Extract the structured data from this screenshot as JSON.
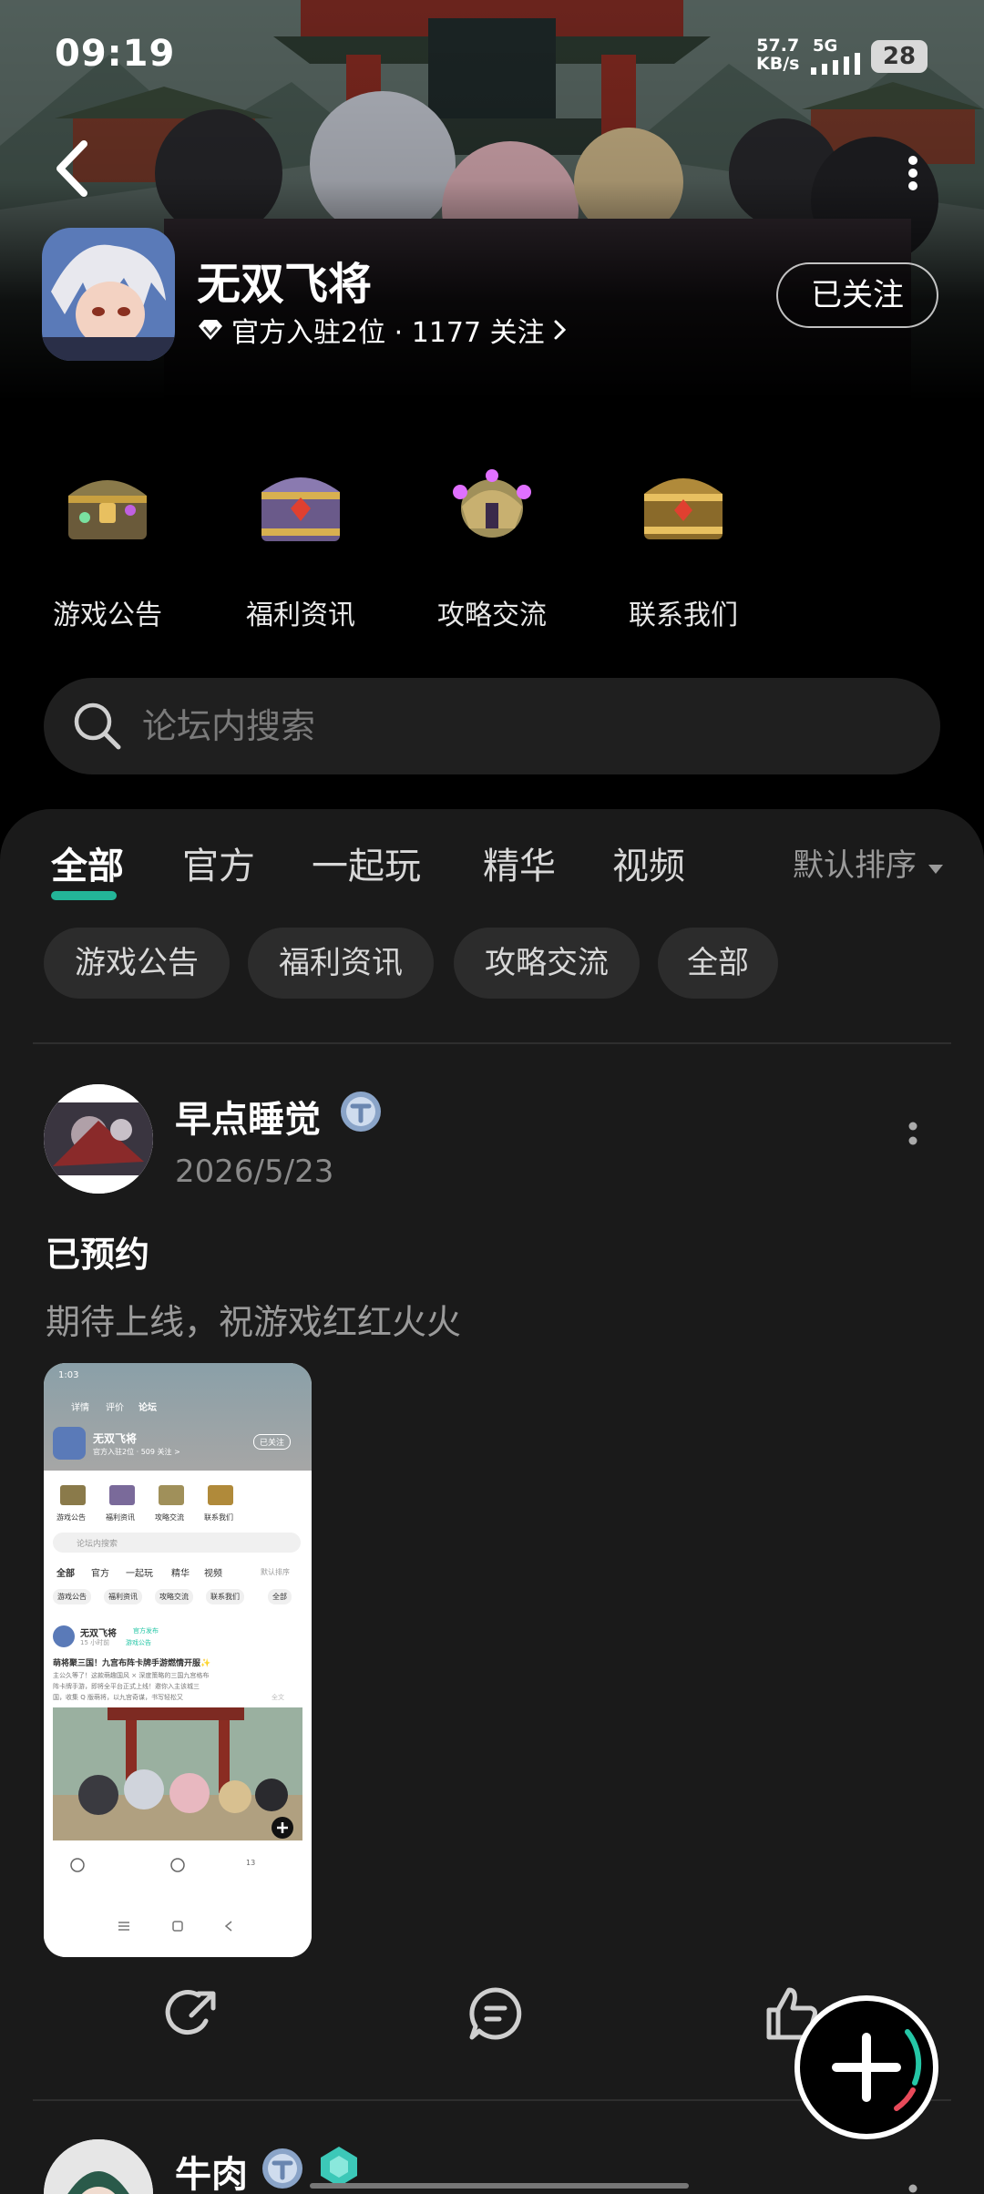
{
  "status_bar": {
    "time": "09:19",
    "net_speed_value": "57.7",
    "net_speed_unit": "KB/s",
    "network": "5G",
    "battery": "28"
  },
  "header": {
    "app_name": "无双飞将",
    "meta": "官方入驻2位 · 1177 关注",
    "follow_label": "已关注"
  },
  "categories": [
    {
      "label": "游戏公告",
      "icon": "chest-icon"
    },
    {
      "label": "福利资讯",
      "icon": "purple-chest-icon"
    },
    {
      "label": "攻略交流",
      "icon": "gold-helmet-icon"
    },
    {
      "label": "联系我们",
      "icon": "gold-chest-icon"
    }
  ],
  "search": {
    "placeholder": "论坛内搜索"
  },
  "tabs": [
    {
      "label": "全部",
      "active": true
    },
    {
      "label": "官方",
      "active": false
    },
    {
      "label": "一起玩",
      "active": false
    },
    {
      "label": "精华",
      "active": false
    },
    {
      "label": "视频",
      "active": false
    }
  ],
  "sort_label": "默认排序",
  "chips": [
    "游戏公告",
    "福利资讯",
    "攻略交流",
    "全部"
  ],
  "post": {
    "author": "早点睡觉",
    "date": "2026/5/23",
    "title": "已预约",
    "body": "期待上线，祝游戏红红火火",
    "screenshot": {
      "time": "1:03",
      "tab_details": "详情",
      "tab_reviews": "评价",
      "tab_forum": "论坛",
      "app_name": "无双飞将",
      "follow": "已关注",
      "meta": "官方入驻2位 · 509 关注 >",
      "cats": [
        "游戏公告",
        "福利资讯",
        "攻略交流",
        "联系我们"
      ],
      "search": "论坛内搜索",
      "tabs": [
        "全部",
        "官方",
        "一起玩",
        "精华",
        "视频"
      ],
      "sort": "默认排序",
      "chips": [
        "游戏公告",
        "福利资讯",
        "攻略交流",
        "联系我们",
        "全部"
      ],
      "post_author": "无双飞将",
      "post_badge": "官方发布",
      "post_time": "15 小时前",
      "post_tag": "游戏公告",
      "post_title": "萌将聚三国！九宫布阵卡牌手游燃情开服✨",
      "post_line1": "主公久等了！这款萌趣国风 × 深度策略的三国九宫格布",
      "post_line2": "阵卡牌手游，即将全平台正式上线！邀你入主该城三",
      "post_line3": "国，收集 Q 版萌将，以九宫奇谋，书写轻松又",
      "post_more": "全文",
      "likes": "13"
    }
  },
  "post2": {
    "author": "牛肉"
  },
  "colors": {
    "accent": "#25c6a6",
    "panel": "#1a1a1a",
    "chip": "#2c2c2c"
  }
}
